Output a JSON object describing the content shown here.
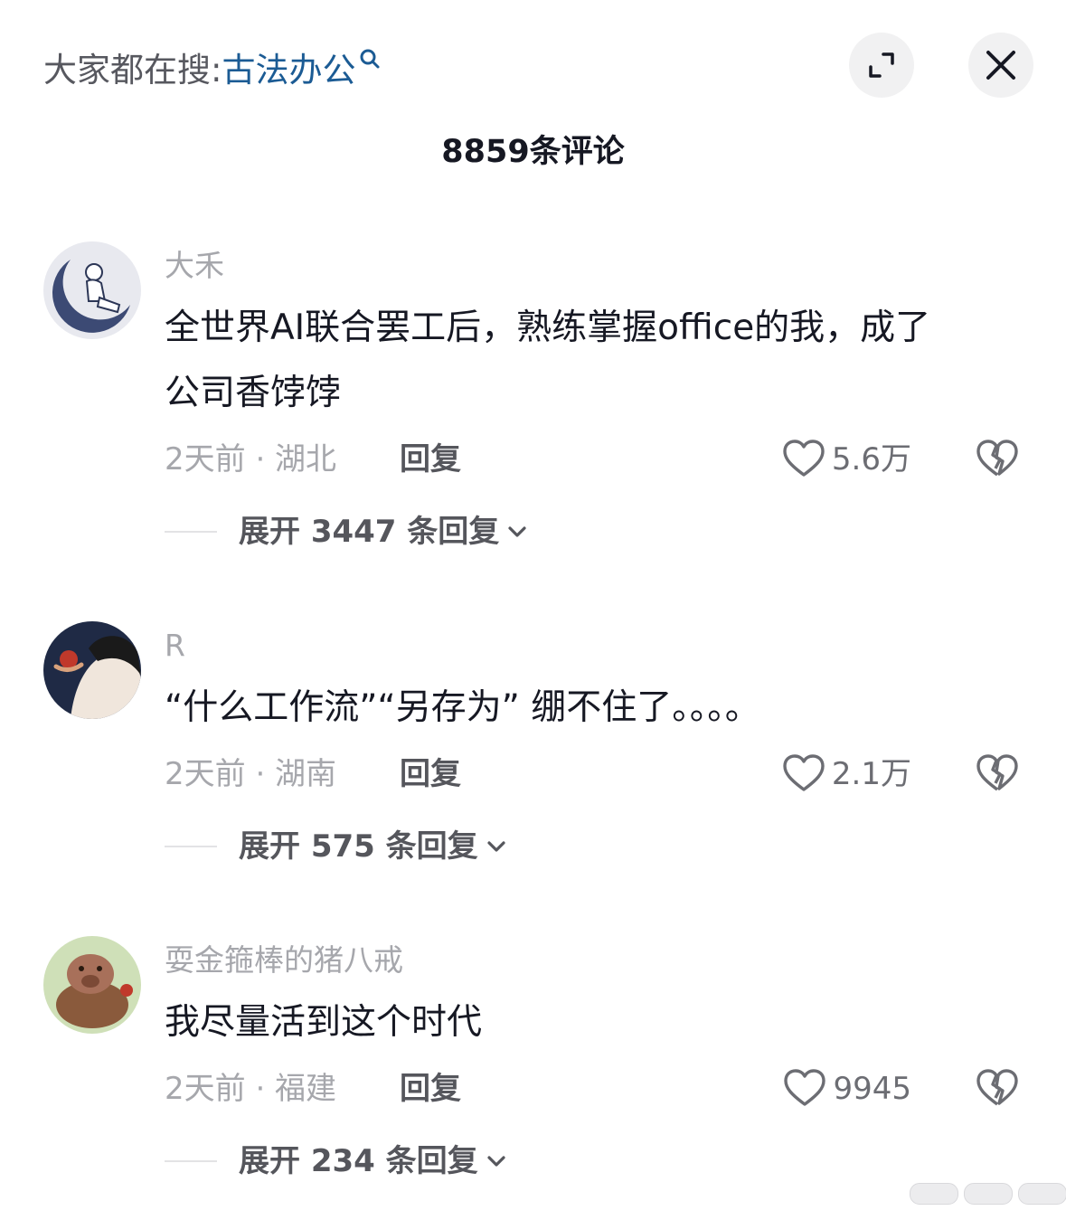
{
  "header": {
    "search_prefix": "大家都在搜: ",
    "search_keyword": "古法办公",
    "search_icon": "search-icon",
    "expand_icon": "fullscreen-icon",
    "close_icon": "close-icon"
  },
  "comment_count_label": "8859条评论",
  "comments": [
    {
      "username": "大禾",
      "content_line1": "全世界AI联合罢工后，熟练掌握office的我，成了",
      "content_line2": "公司香饽饽",
      "time_location": "2天前 · 湖北",
      "reply_label": "回复",
      "likes": "5.6万",
      "expand_label": "展开 3447 条回复",
      "avatar": "astronaut-on-moon-avatar"
    },
    {
      "username": "R",
      "content_line1": "“什么工作流”“另存为” 绷不住了。。。。",
      "time_location": "2天前 · 湖南",
      "reply_label": "回复",
      "likes": "2.1万",
      "expand_label": "展开 575 条回复",
      "avatar": "woman-portrait-avatar"
    },
    {
      "username": "耍金箍棒的猪八戒",
      "content_line1": "我尽量活到这个时代",
      "time_location": "2天前 · 福建",
      "reply_label": "回复",
      "likes": "9945",
      "expand_label": "展开 234 条回复",
      "avatar": "pig-character-avatar"
    }
  ],
  "colors": {
    "keyword": "#1b5b94",
    "primary_text": "#161823",
    "secondary_text": "#a6a7ac",
    "button_bg": "#f1f1f2"
  }
}
